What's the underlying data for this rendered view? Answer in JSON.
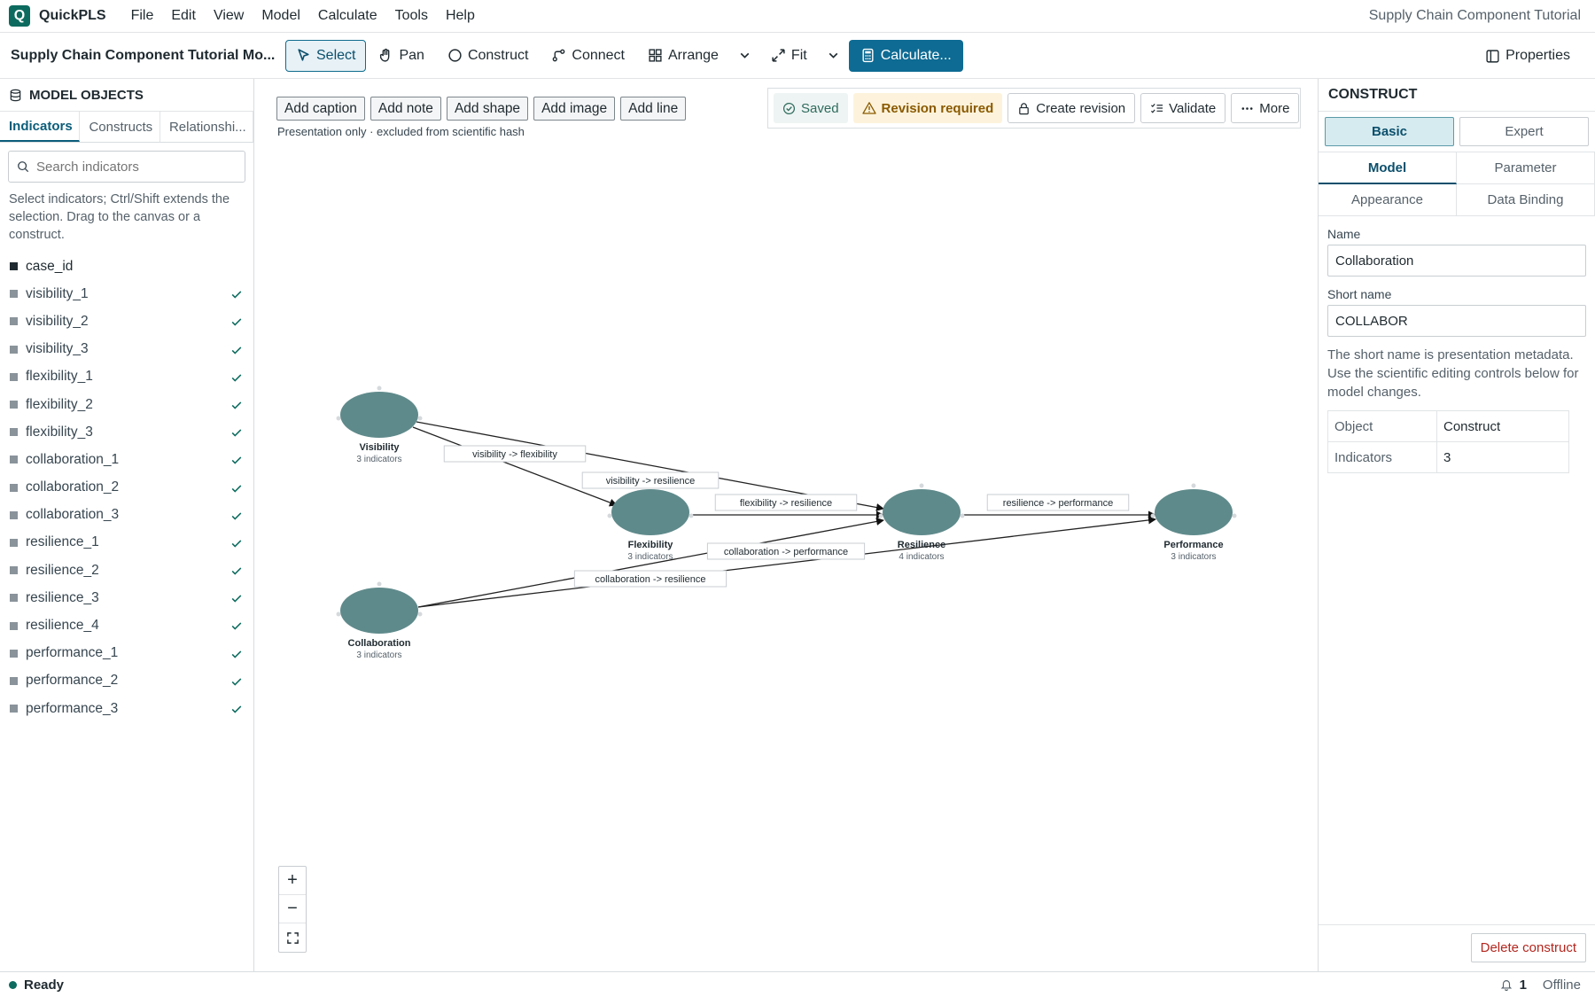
{
  "app": {
    "logo_letter": "Q",
    "name": "QuickPLS",
    "window_title": "Supply Chain Component Tutorial"
  },
  "menu": [
    "File",
    "Edit",
    "View",
    "Model",
    "Calculate",
    "Tools",
    "Help"
  ],
  "toolbar": {
    "document_title": "Supply Chain Component Tutorial Mo...",
    "select": "Select",
    "pan": "Pan",
    "construct": "Construct",
    "connect": "Connect",
    "arrange": "Arrange",
    "fit": "Fit",
    "calculate": "Calculate...",
    "properties": "Properties"
  },
  "left_panel": {
    "title": "MODEL OBJECTS",
    "tabs": [
      "Indicators",
      "Constructs",
      "Relationshi..."
    ],
    "search_placeholder": "Search indicators",
    "hint": "Select indicators; Ctrl/Shift extends the selection. Drag to the canvas or a construct.",
    "indicators": [
      {
        "name": "case_id",
        "assigned": false
      },
      {
        "name": "visibility_1",
        "assigned": true
      },
      {
        "name": "visibility_2",
        "assigned": true
      },
      {
        "name": "visibility_3",
        "assigned": true
      },
      {
        "name": "flexibility_1",
        "assigned": true
      },
      {
        "name": "flexibility_2",
        "assigned": true
      },
      {
        "name": "flexibility_3",
        "assigned": true
      },
      {
        "name": "collaboration_1",
        "assigned": true
      },
      {
        "name": "collaboration_2",
        "assigned": true
      },
      {
        "name": "collaboration_3",
        "assigned": true
      },
      {
        "name": "resilience_1",
        "assigned": true
      },
      {
        "name": "resilience_2",
        "assigned": true
      },
      {
        "name": "resilience_3",
        "assigned": true
      },
      {
        "name": "resilience_4",
        "assigned": true
      },
      {
        "name": "performance_1",
        "assigned": true
      },
      {
        "name": "performance_2",
        "assigned": true
      },
      {
        "name": "performance_3",
        "assigned": true
      }
    ]
  },
  "canvas": {
    "buttons": [
      "Add caption",
      "Add note",
      "Add shape",
      "Add image",
      "Add line"
    ],
    "note": "Presentation only · excluded from scientific hash",
    "status": {
      "saved": "Saved",
      "revision": "Revision required",
      "create_revision": "Create revision",
      "validate": "Validate",
      "more": "More"
    },
    "constructs": [
      {
        "id": "visibility",
        "name": "Visibility",
        "sub": "3 indicators"
      },
      {
        "id": "flexibility",
        "name": "Flexibility",
        "sub": "3 indicators"
      },
      {
        "id": "collaboration",
        "name": "Collaboration",
        "sub": "3 indicators"
      },
      {
        "id": "resilience",
        "name": "Resilience",
        "sub": "4 indicators"
      },
      {
        "id": "performance",
        "name": "Performance",
        "sub": "3 indicators"
      }
    ],
    "paths": [
      {
        "from": "visibility",
        "to": "flexibility",
        "label": "visibility -> flexibility"
      },
      {
        "from": "visibility",
        "to": "resilience",
        "label": "visibility -> resilience"
      },
      {
        "from": "flexibility",
        "to": "resilience",
        "label": "flexibility -> resilience"
      },
      {
        "from": "resilience",
        "to": "performance",
        "label": "resilience -> performance"
      },
      {
        "from": "collaboration",
        "to": "performance",
        "label": "collaboration -> performance"
      },
      {
        "from": "collaboration",
        "to": "resilience",
        "label": "collaboration -> resilience"
      }
    ],
    "node_color": "#5f8a8b"
  },
  "right_panel": {
    "title": "CONSTRUCT",
    "modes": [
      "Basic",
      "Expert"
    ],
    "tabs": [
      "Model",
      "Parameter",
      "Appearance",
      "Data Binding"
    ],
    "name_label": "Name",
    "name_value": "Collaboration",
    "short_label": "Short name",
    "short_value": "COLLABOR",
    "note": "The short name is presentation metadata. Use the scientific editing controls below for model changes.",
    "table": [
      {
        "k": "Object",
        "v": "Construct"
      },
      {
        "k": "Indicators",
        "v": "3"
      }
    ],
    "delete": "Delete construct"
  },
  "statusbar": {
    "state": "Ready",
    "notifications": "1",
    "connection": "Offline"
  },
  "colors": {
    "accent": "#0e6b93",
    "brand": "#0c6b5e",
    "warning_bg": "#fdf3dc"
  }
}
